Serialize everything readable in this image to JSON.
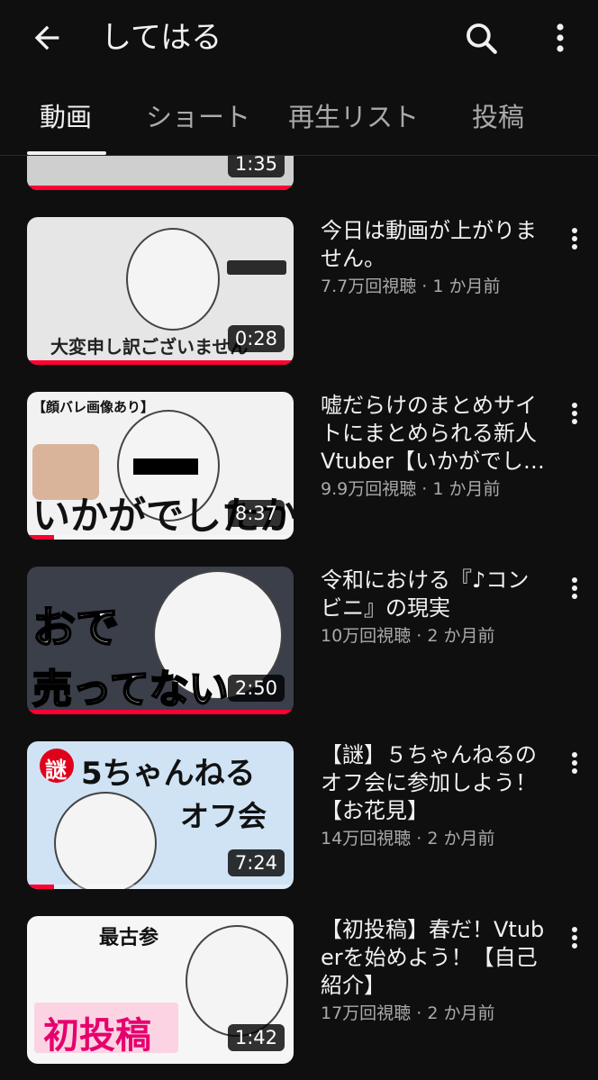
{
  "header": {
    "title": "してはる"
  },
  "tabs": [
    {
      "label": "動画",
      "active": true
    },
    {
      "label": "ショート",
      "active": false
    },
    {
      "label": "再生リスト",
      "active": false
    },
    {
      "label": "投稿",
      "active": false
    }
  ],
  "partial_item": {
    "duration": "1:35"
  },
  "videos": [
    {
      "title": "今日は動画が上がりません。",
      "views": "7.7万回視聴",
      "age": "1 か月前",
      "duration": "0:28",
      "thumb_caption": "大変申し訳ございません"
    },
    {
      "title": "嘘だらけのまとめサイトにまとめられる新人Vtuber【いかがでし…",
      "views": "9.9万回視聴",
      "age": "1 か月前",
      "duration": "8:37",
      "thumb_caption": "いかがでしたか?",
      "thumb_header": "【顔バレ画像あり】"
    },
    {
      "title": "令和における『♪コンビニ』の現実",
      "views": "10万回視聴",
      "age": "2 か月前",
      "duration": "2:50",
      "thumb_caption": "売ってない",
      "thumb_header": "おで"
    },
    {
      "title": "【謎】５ちゃんねるのオフ会に参加しよう！【お花見】",
      "views": "14万回視聴",
      "age": "2 か月前",
      "duration": "7:24",
      "thumb_caption": "オフ会",
      "thumb_header": "5ちゃんねる",
      "thumb_badge": "謎"
    },
    {
      "title": "【初投稿】春だ！Vtuberを始めよう！【自己紹介】",
      "views": "17万回視聴",
      "age": "2 か月前",
      "duration": "1:42",
      "thumb_caption": "初投稿",
      "thumb_header": "最古参"
    }
  ],
  "separator": "·",
  "colors": {
    "background": "#0f0f0f",
    "progress": "#ff0033",
    "secondary_text": "#aaaaaa"
  }
}
